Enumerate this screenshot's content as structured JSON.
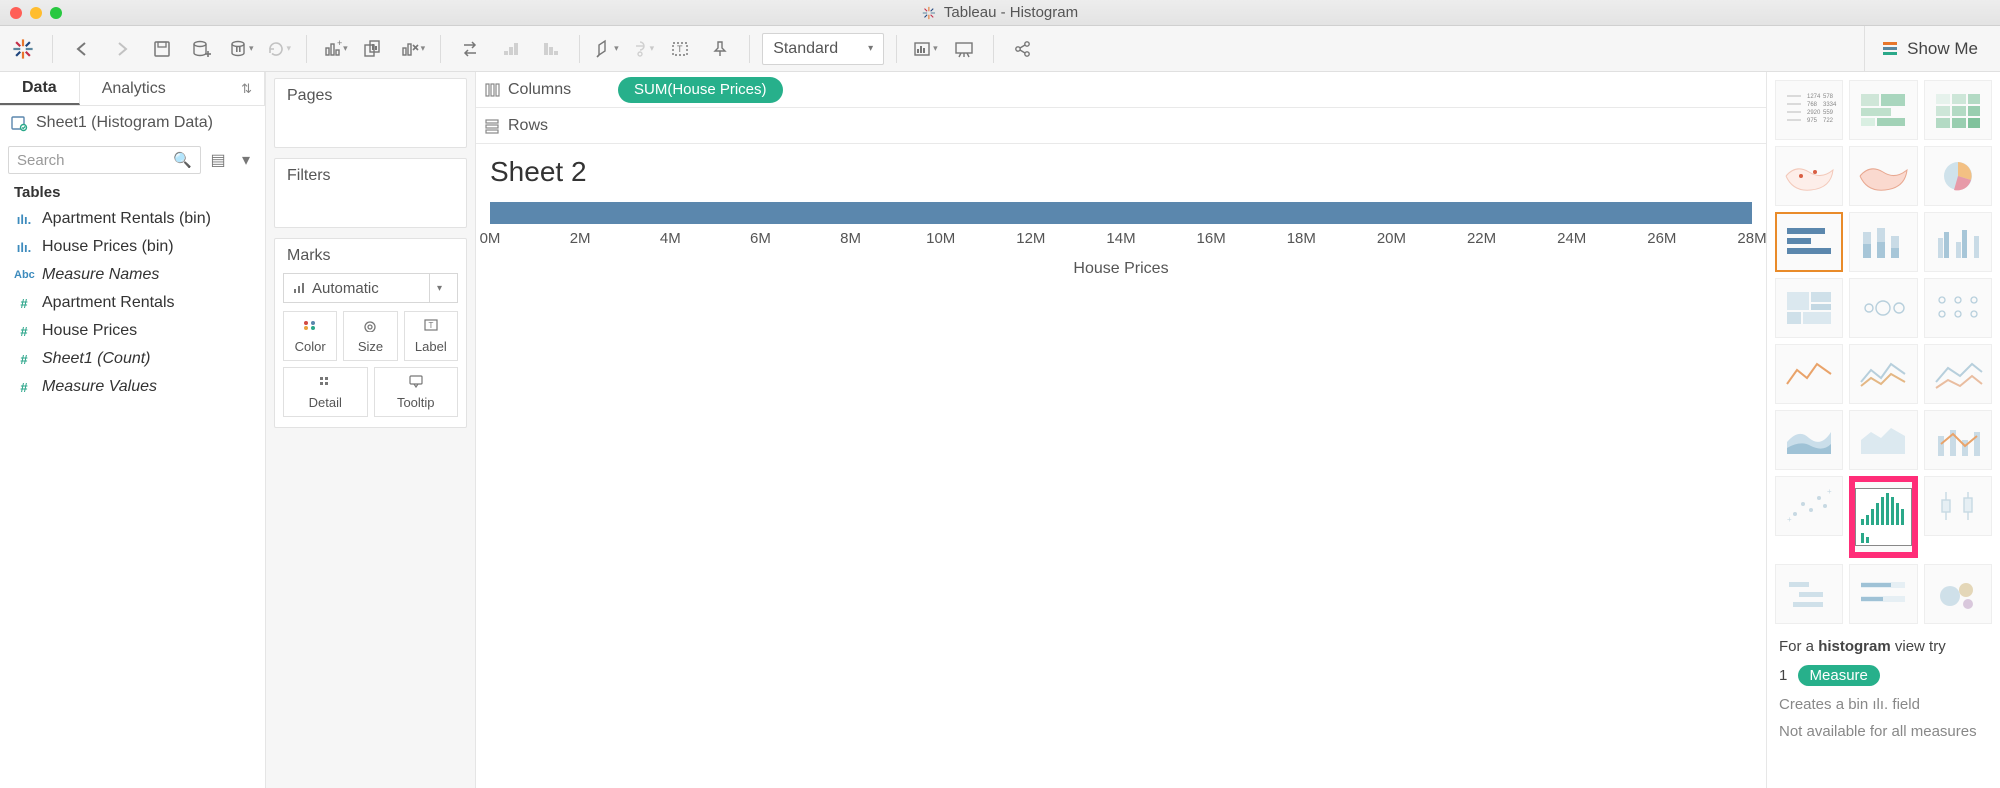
{
  "window": {
    "title": "Tableau - Histogram"
  },
  "toolbar": {
    "fit_mode": "Standard",
    "show_me": "Show Me"
  },
  "data_panel": {
    "tabs": {
      "data": "Data",
      "analytics": "Analytics"
    },
    "datasource": "Sheet1 (Histogram Data)",
    "search_placeholder": "Search",
    "tables_header": "Tables",
    "fields": [
      {
        "icon": "bar-blue",
        "label": "Apartment Rentals (bin)",
        "italic": false
      },
      {
        "icon": "bar-blue",
        "label": "House Prices (bin)",
        "italic": false
      },
      {
        "icon": "abc-blue",
        "label": "Measure Names",
        "italic": true
      },
      {
        "icon": "hash-teal",
        "label": "Apartment Rentals",
        "italic": false
      },
      {
        "icon": "hash-teal",
        "label": "House Prices",
        "italic": false
      },
      {
        "icon": "hash-teal",
        "label": "Sheet1 (Count)",
        "italic": true
      },
      {
        "icon": "hash-teal",
        "label": "Measure Values",
        "italic": true
      }
    ]
  },
  "cards": {
    "pages": "Pages",
    "filters": "Filters",
    "marks": "Marks",
    "mark_type": "Automatic",
    "cells": {
      "color": "Color",
      "size": "Size",
      "label": "Label",
      "detail": "Detail",
      "tooltip": "Tooltip"
    }
  },
  "shelves": {
    "columns_label": "Columns",
    "rows_label": "Rows",
    "columns_pill": "SUM(House Prices)"
  },
  "worksheet": {
    "title": "Sheet 2",
    "x_axis_title": "House Prices"
  },
  "chart_data": {
    "type": "bar",
    "orientation": "horizontal",
    "title": "Sheet 2",
    "xlabel": "House Prices",
    "x_ticks": [
      "0M",
      "2M",
      "4M",
      "6M",
      "8M",
      "10M",
      "12M",
      "14M",
      "16M",
      "18M",
      "20M",
      "22M",
      "24M",
      "26M",
      "28M"
    ],
    "xlim": [
      0,
      28
    ],
    "series": [
      {
        "name": "SUM(House Prices)",
        "values": [
          28
        ]
      }
    ]
  },
  "showme": {
    "hint_prefix": "For a ",
    "hint_bold": "histogram",
    "hint_suffix": " view try",
    "count": "1",
    "measure": "Measure",
    "note1_a": "Creates a bin ",
    "note1_b": " field",
    "note2": "Not available for all measures"
  }
}
